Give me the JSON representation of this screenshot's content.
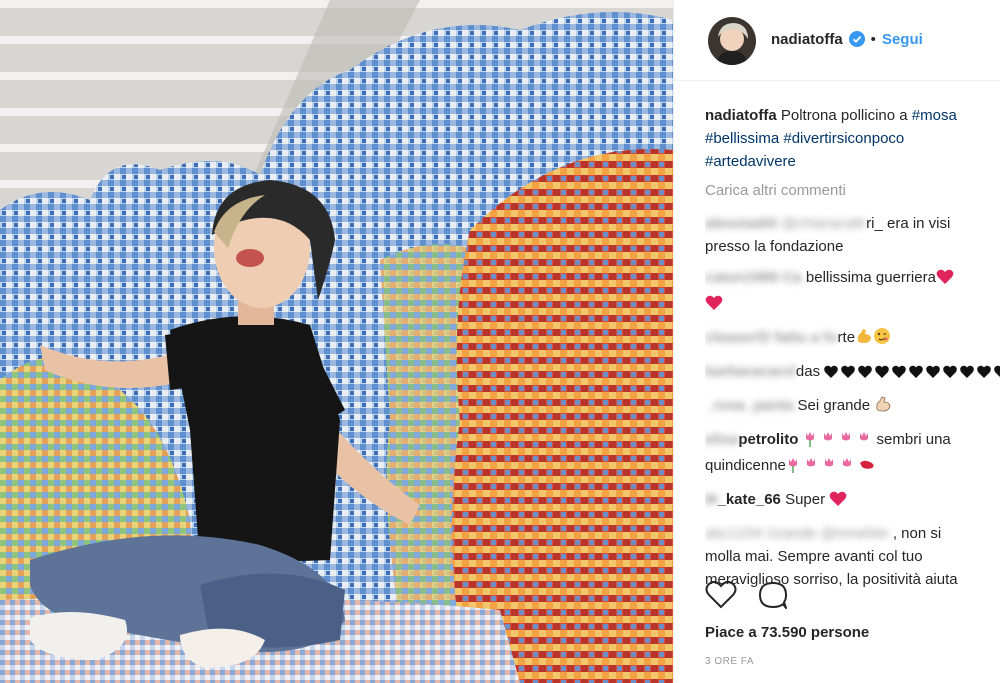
{
  "post": {
    "username": "nadiatoffa",
    "follow_label": "Segui",
    "separator": "•",
    "avatar_icon": "avatar-photo",
    "verified_icon": "verified-badge-icon"
  },
  "caption": {
    "username": "nadiatoffa",
    "text": "Poltrona pollicino a",
    "hashtag_1": "#mosa",
    "hashtag_2": "#bellissima",
    "hashtag_3": "#divertirsiconpoco",
    "hashtag_4": "#artedavivere"
  },
  "load_more_label": "Carica altri commenti",
  "comments": [
    {
      "user_blur": "alessiaditi",
      "mention_blur": "@chiaracaltr",
      "tail": "ri_ era in visi",
      "line2": "presso la fondazione"
    },
    {
      "user_blur": "catun1989 Ca",
      "text": "bellissima guerriera"
    },
    {
      "user_blur": "cleaserf2 fattu a fo",
      "text": "rte"
    },
    {
      "user_blur": "barbaracarol",
      "text": "das"
    },
    {
      "user_blur": "_rosa_panta",
      "text": "Sei grande"
    },
    {
      "user_blur": "elisa",
      "user_visible": "petrolito",
      "text": "sembri una",
      "line2": "quindicenne"
    },
    {
      "user_blur": "M",
      "user_visible": "_kate_66",
      "text": "Super"
    },
    {
      "user_blur": "abc1234 Grande @mrwhite",
      "tail": ", non si",
      "line2": "molla mai. Sempre avanti col tuo",
      "line3": "meraviglioso sorriso, la positività aiuta"
    }
  ],
  "actions": {
    "like_icon": "heart-outline-icon",
    "comment_icon": "comment-bubble-icon"
  },
  "likes_label": "Piace a 73.590 persone",
  "time_label": "3 ORE FA",
  "colors": {
    "link": "#003569",
    "follow": "#3897f0",
    "muted": "#999999",
    "heart": "#ed4956"
  }
}
